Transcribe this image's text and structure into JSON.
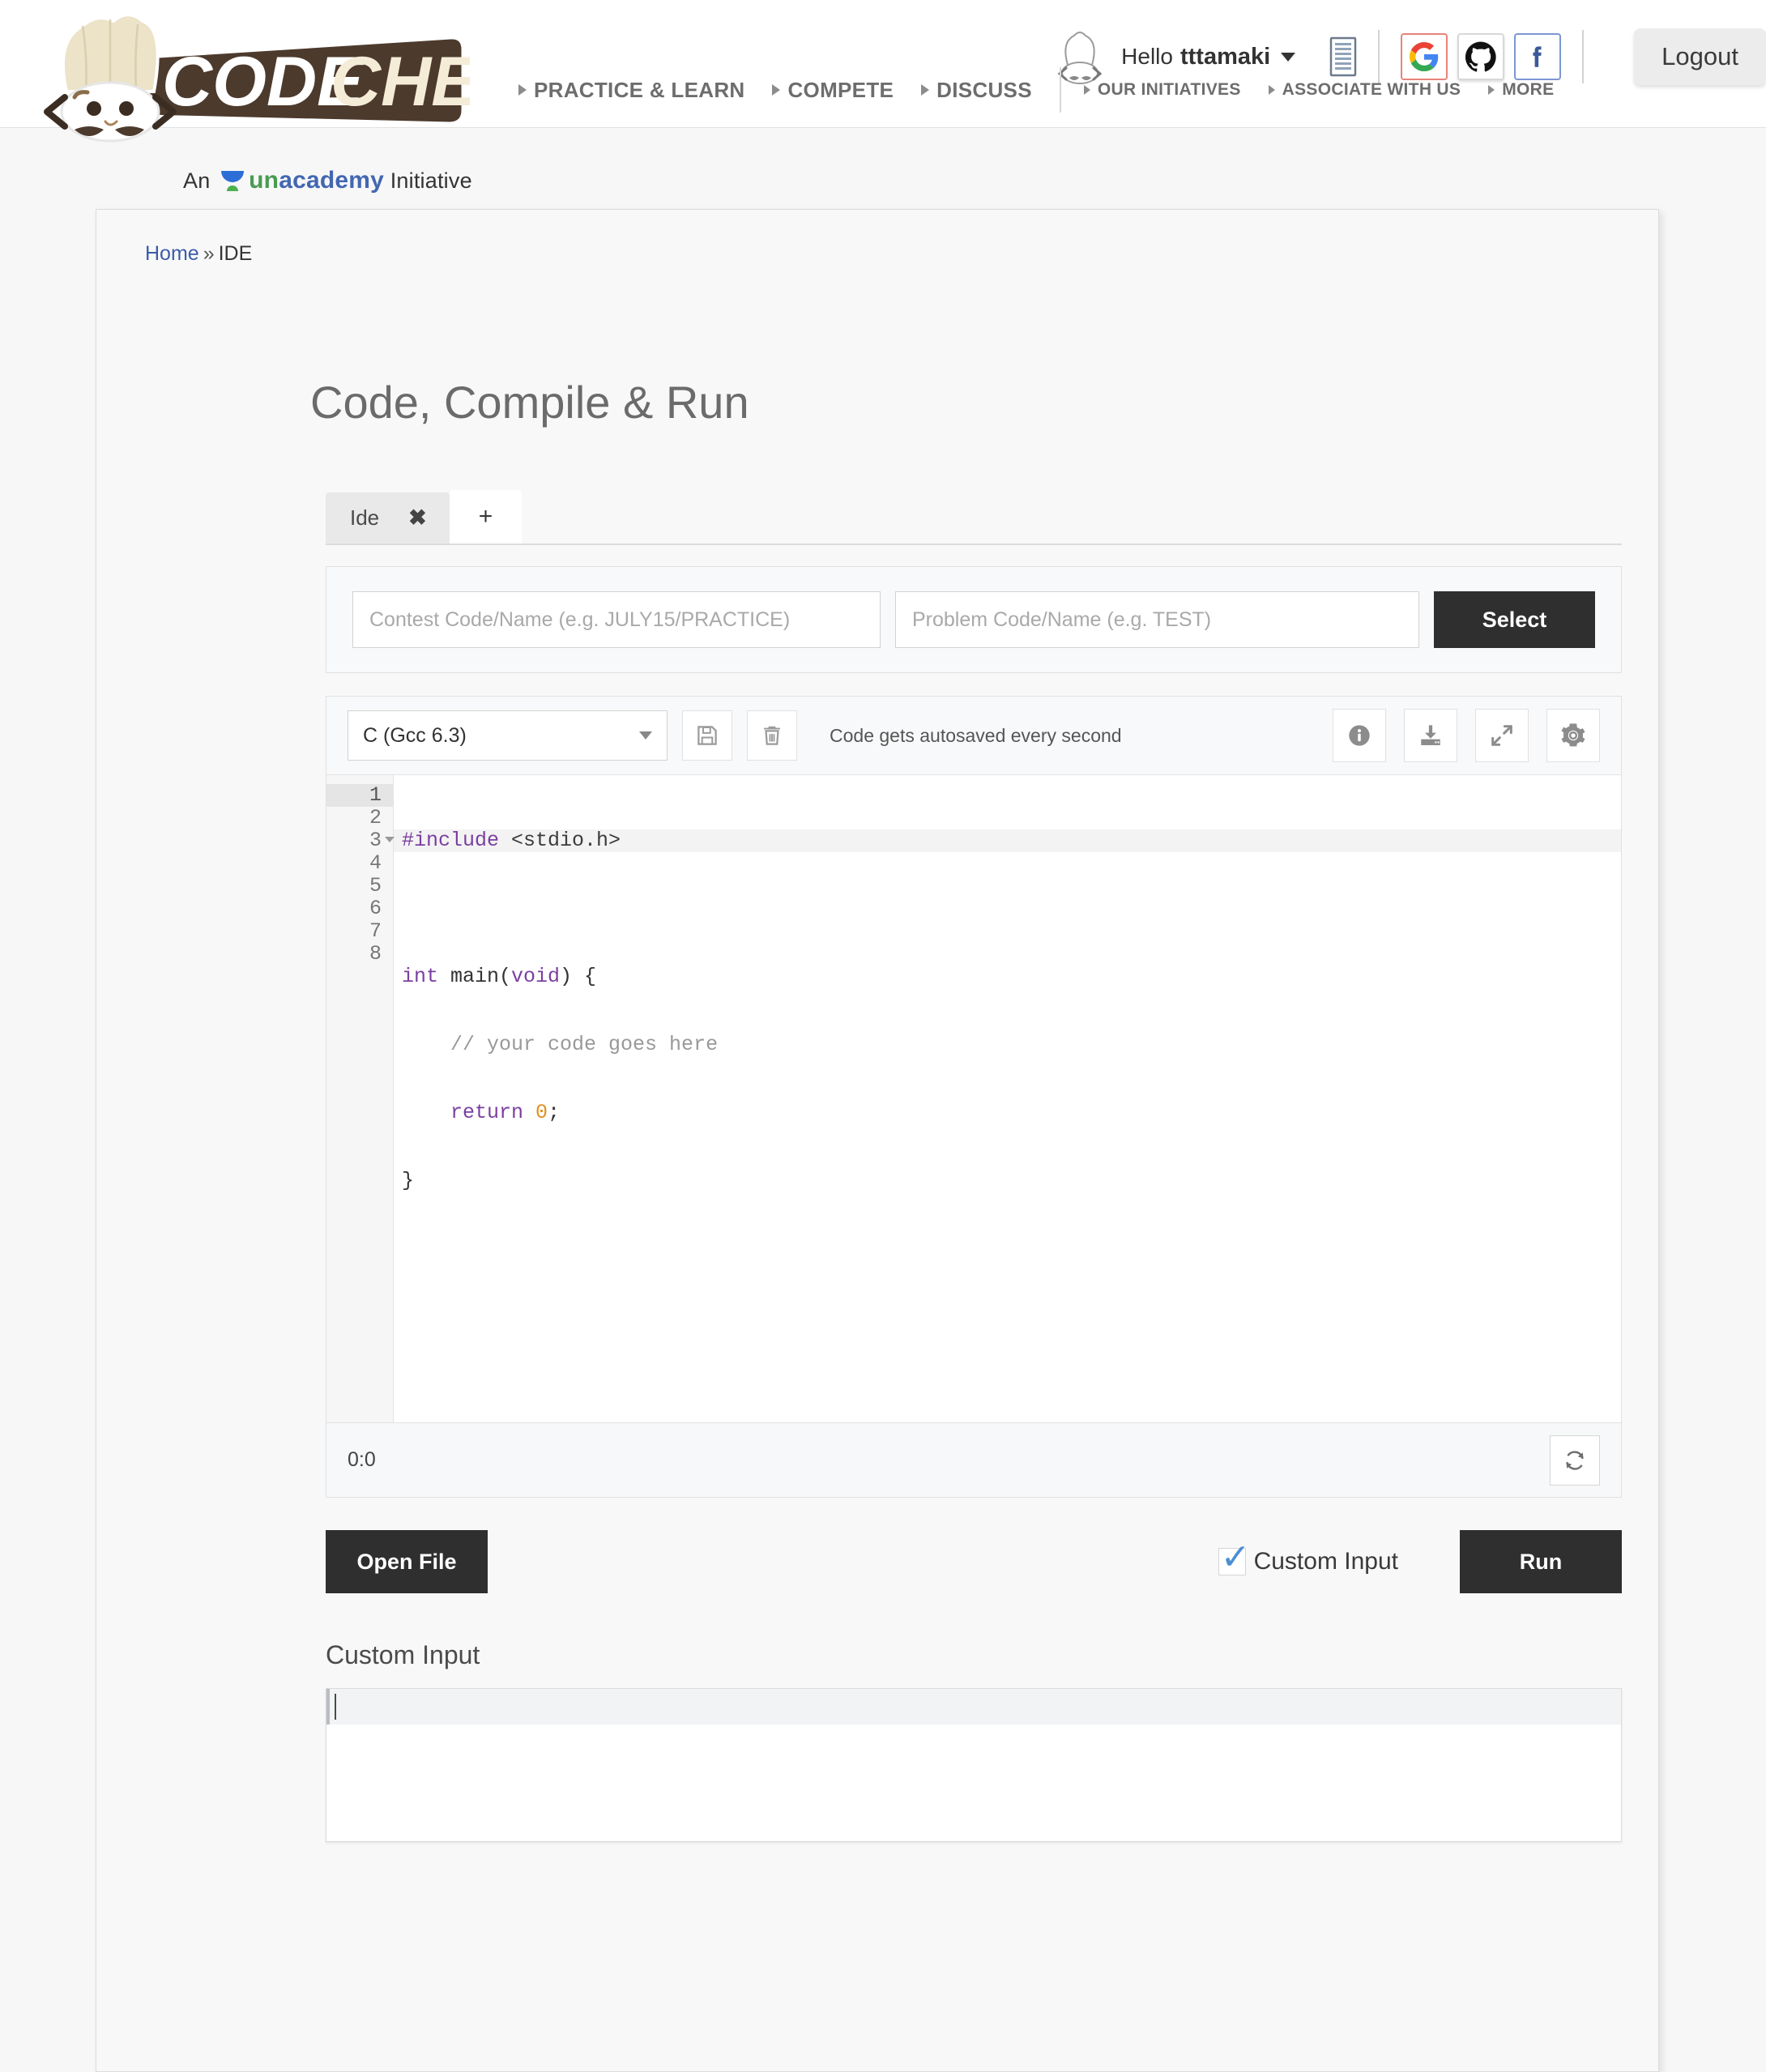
{
  "brand": {
    "logo_text": "CODECHEF",
    "tagline_prefix": "An",
    "tagline_brand_a": "un",
    "tagline_brand_b": "academy",
    "tagline_suffix": "Initiative"
  },
  "header": {
    "greeting_prefix": "Hello",
    "username": "tttamaki",
    "logout_label": "Logout",
    "icons": {
      "chef_hat": "chef-hat-icon",
      "notes": "notes-icon",
      "google": "google-icon",
      "github": "github-icon",
      "facebook": "facebook-icon",
      "caret": "chevron-down-icon"
    }
  },
  "nav": {
    "primary": [
      "PRACTICE & LEARN",
      "COMPETE",
      "DISCUSS"
    ],
    "secondary": [
      "OUR INITIATIVES",
      "ASSOCIATE WITH US",
      "MORE"
    ]
  },
  "breadcrumb": {
    "home": "Home",
    "separator": "»",
    "current": "IDE"
  },
  "page": {
    "title": "Code, Compile & Run"
  },
  "tabs": {
    "items": [
      {
        "label": "Ide",
        "close": "✖"
      }
    ],
    "add_label": "+"
  },
  "problem_selector": {
    "contest_placeholder": "Contest Code/Name (e.g. JULY15/PRACTICE)",
    "contest_value": "",
    "problem_placeholder": "Problem Code/Name (e.g. TEST)",
    "problem_value": "",
    "select_label": "Select"
  },
  "editor": {
    "language": "C (Gcc 6.3)",
    "language_options": [
      "C (Gcc 6.3)"
    ],
    "autosave_note": "Code gets autosaved every second",
    "toolbar_icons": {
      "save": "save-icon",
      "delete": "trash-icon",
      "info": "info-icon",
      "download": "download-icon",
      "fullscreen": "expand-icon",
      "settings": "gear-icon",
      "refresh": "refresh-icon"
    },
    "line_numbers": [
      "1",
      "2",
      "3",
      "4",
      "5",
      "6",
      "7",
      "8"
    ],
    "code_lines": [
      "#include <stdio.h>",
      "",
      "int main(void) {",
      "    // your code goes here",
      "    return 0;",
      "}",
      "",
      ""
    ],
    "cursor_position": "0:0"
  },
  "actions": {
    "open_file_label": "Open File",
    "custom_input_label": "Custom Input",
    "custom_input_checked": true,
    "run_label": "Run"
  },
  "custom_input": {
    "heading": "Custom Input",
    "value": ""
  },
  "colors": {
    "brand_brown": "#4c3a2d",
    "brand_cream": "#f5ecd7",
    "dark_button": "#2f2f2f",
    "link_blue": "#3c5ba9",
    "check_blue": "#4a8fd4",
    "unacademy_green": "#4a9b52",
    "unacademy_blue": "#4267b2",
    "syntax_keyword": "#7b3fa0",
    "syntax_comment": "#999999",
    "syntax_number": "#e09020"
  }
}
